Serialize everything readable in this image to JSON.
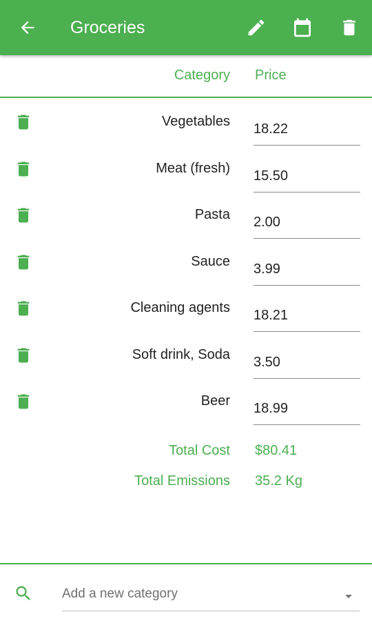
{
  "app_bar": {
    "title": "Groceries",
    "icons": [
      "arrow-back-icon",
      "pencil-icon",
      "calendar-icon",
      "trash-icon"
    ],
    "color": "#4caf50"
  },
  "table": {
    "headers": {
      "category": "Category",
      "price": "Price"
    },
    "rows": [
      {
        "category": "Vegetables",
        "price": "18.22"
      },
      {
        "category": "Meat (fresh)",
        "price": "15.50"
      },
      {
        "category": "Pasta",
        "price": "2.00"
      },
      {
        "category": "Sauce",
        "price": "3.99"
      },
      {
        "category": "Cleaning agents",
        "price": "18.21"
      },
      {
        "category": "Soft drink, Soda",
        "price": "3.50"
      },
      {
        "category": "Beer",
        "price": "18.99"
      }
    ]
  },
  "totals": {
    "cost_label": "Total Cost",
    "cost_value": "$80.41",
    "emissions_label": "Total Emissions",
    "emissions_value": "35.2 Kg"
  },
  "add_category": {
    "placeholder": "Add a new category",
    "value": ""
  }
}
